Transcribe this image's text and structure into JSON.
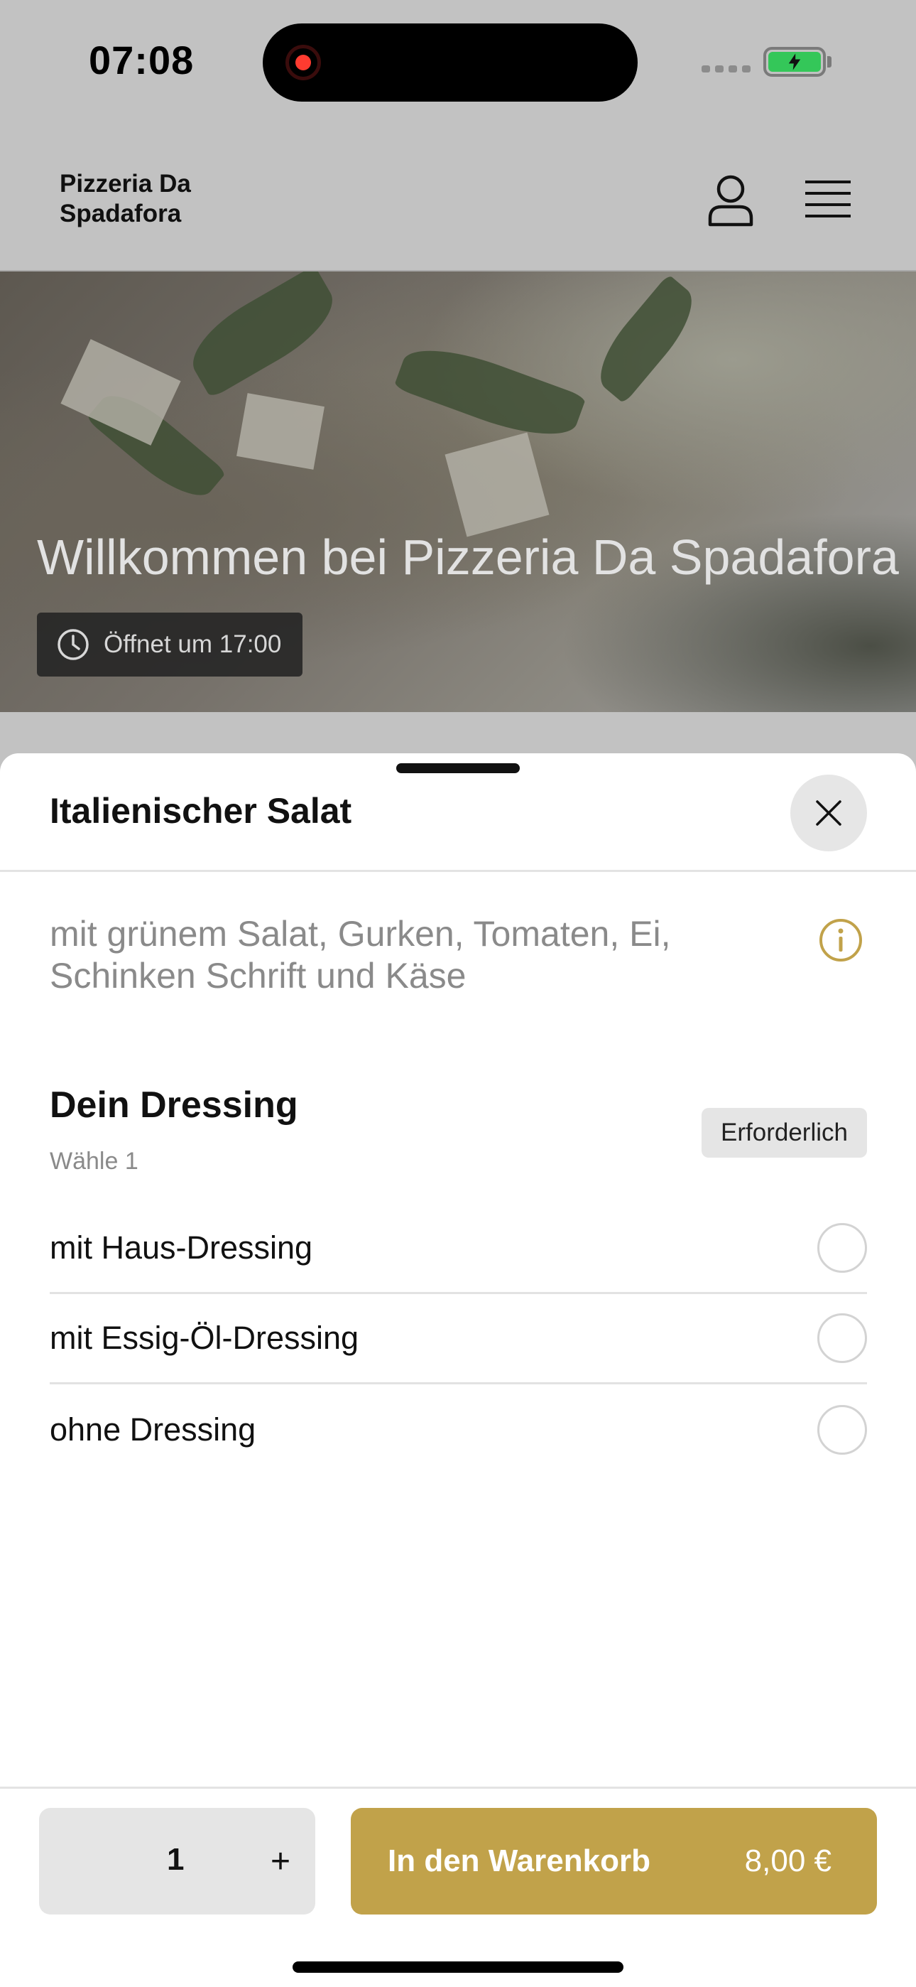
{
  "status_bar": {
    "time": "07:08"
  },
  "header": {
    "brand": "Pizzeria Da Spadafora"
  },
  "hero": {
    "title": "Willkommen bei Pizzeria Da Spadafora",
    "opening": "Öffnet um 17:00"
  },
  "sheet": {
    "title": "Italienischer Salat",
    "description": "mit grünem Salat, Gurken, Tomaten, Ei, Schinken Schrift und Käse",
    "group": {
      "title": "Dein Dressing",
      "subtitle": "Wähle 1",
      "badge": "Erforderlich",
      "options": [
        {
          "label": "mit Haus-Dressing",
          "selected": false
        },
        {
          "label": "mit Essig-Öl-Dressing",
          "selected": false
        },
        {
          "label": "ohne Dressing",
          "selected": false
        }
      ]
    },
    "footer": {
      "quantity": "1",
      "plus": "+",
      "cart_label": "In den Warenkorb",
      "price": "8,00 €"
    }
  },
  "colors": {
    "accent": "#c1a24a",
    "overlay": "#c2c2c2",
    "recording": "#ff3b30",
    "battery": "#34c759"
  },
  "icons": [
    "record-icon",
    "signal-icon",
    "battery-icon",
    "user-icon",
    "menu-icon",
    "clock-icon",
    "close-icon",
    "info-icon"
  ]
}
